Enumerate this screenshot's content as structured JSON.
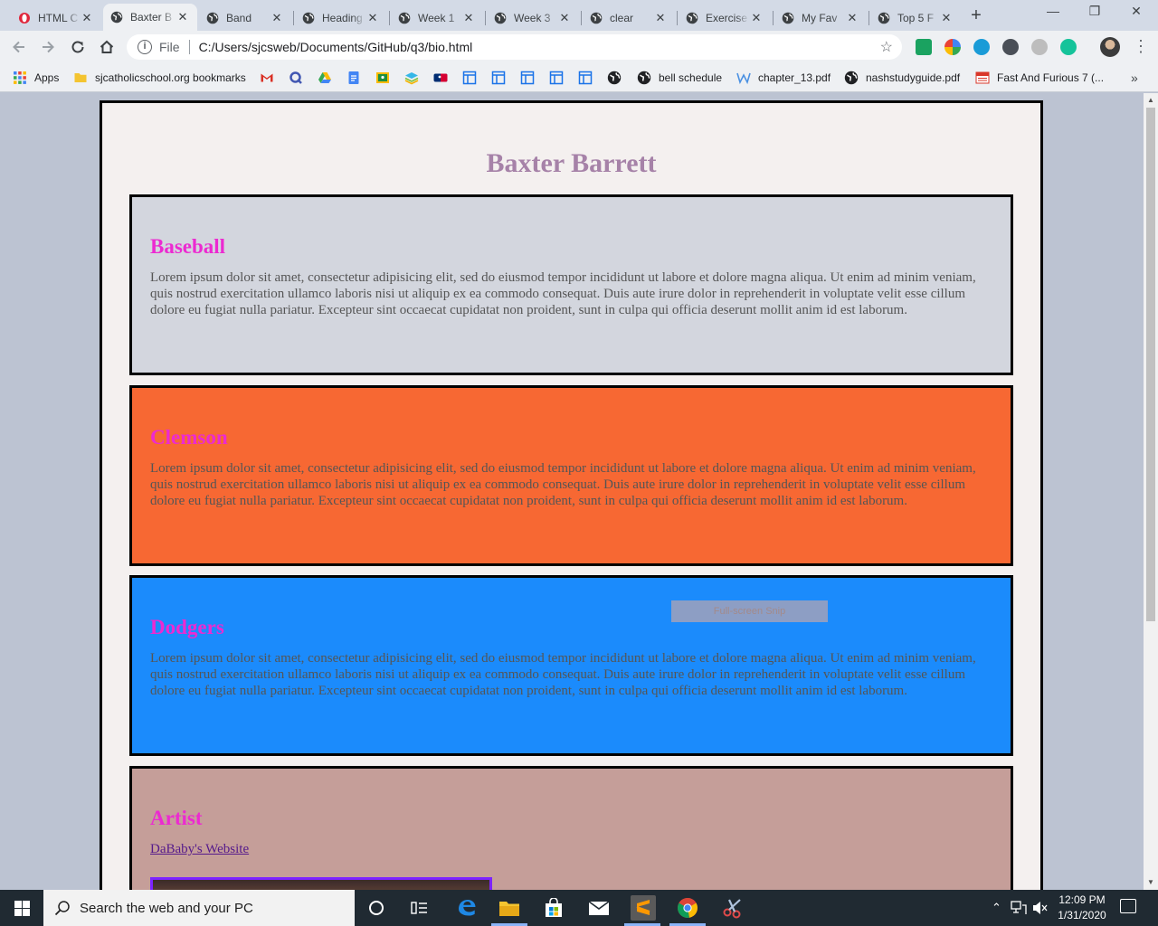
{
  "browser": {
    "tabs": [
      {
        "label": "HTML C",
        "icon": "opera-icon"
      },
      {
        "label": "Baxter B",
        "icon": "globe-icon",
        "active": true
      },
      {
        "label": "Band",
        "icon": "globe-icon"
      },
      {
        "label": "Heading",
        "icon": "globe-icon"
      },
      {
        "label": "Week 1",
        "icon": "globe-icon"
      },
      {
        "label": "Week 3",
        "icon": "globe-icon"
      },
      {
        "label": "clear",
        "icon": "globe-icon"
      },
      {
        "label": "Exercise",
        "icon": "globe-icon"
      },
      {
        "label": "My Fav",
        "icon": "globe-icon"
      },
      {
        "label": "Top 5 F",
        "icon": "globe-icon"
      }
    ],
    "address": {
      "scheme_label": "File",
      "url": "C:/Users/sjcsweb/Documents/GitHub/q3/bio.html"
    },
    "bookmarks": [
      {
        "label": "Apps",
        "icon": "apps-grid-icon"
      },
      {
        "label": "sjcatholicschool.org bookmarks",
        "icon": "folder-icon"
      },
      {
        "label": "",
        "icon": "gmail-icon"
      },
      {
        "label": "",
        "icon": "quizlet-icon"
      },
      {
        "label": "",
        "icon": "google-drive-icon"
      },
      {
        "label": "",
        "icon": "google-docs-icon"
      },
      {
        "label": "",
        "icon": "google-classroom-icon"
      },
      {
        "label": "",
        "icon": "layers-icon"
      },
      {
        "label": "",
        "icon": "mlb-icon"
      },
      {
        "label": "",
        "icon": "page-layout-icon"
      },
      {
        "label": "",
        "icon": "page-layout-icon"
      },
      {
        "label": "",
        "icon": "page-layout-icon"
      },
      {
        "label": "",
        "icon": "page-layout-icon"
      },
      {
        "label": "",
        "icon": "page-layout-icon"
      },
      {
        "label": "",
        "icon": "globe-icon"
      },
      {
        "label": "bell schedule",
        "icon": "globe-icon"
      },
      {
        "label": "chapter_13.pdf",
        "icon": "word-w-icon"
      },
      {
        "label": "nashstudyguide.pdf",
        "icon": "globe-icon"
      },
      {
        "label": "Fast And Furious 7 (...",
        "icon": "calendar-icon"
      }
    ]
  },
  "page": {
    "title": "Baxter Barrett",
    "sections": [
      {
        "heading": "Baseball",
        "body": "Lorem ipsum dolor sit amet, consectetur adipisicing elit, sed do eiusmod tempor incididunt ut labore et dolore magna aliqua. Ut enim ad minim veniam, quis nostrud exercitation ullamco laboris nisi ut aliquip ex ea commodo consequat. Duis aute irure dolor in reprehenderit in voluptate velit esse cillum dolore eu fugiat nulla pariatur. Excepteur sint occaecat cupidatat non proident, sunt in culpa qui officia deserunt mollit anim id est laborum.",
        "background": "#d3d6de"
      },
      {
        "heading": "Clemson",
        "body": "Lorem ipsum dolor sit amet, consectetur adipisicing elit, sed do eiusmod tempor incididunt ut labore et dolore magna aliqua. Ut enim ad minim veniam, quis nostrud exercitation ullamco laboris nisi ut aliquip ex ea commodo consequat. Duis aute irure dolor in reprehenderit in voluptate velit esse cillum dolore eu fugiat nulla pariatur. Excepteur sint occaecat cupidatat non proident, sunt in culpa qui officia deserunt mollit anim id est laborum.",
        "background": "#f76833"
      },
      {
        "heading": "Dodgers",
        "body": "Lorem ipsum dolor sit amet, consectetur adipisicing elit, sed do eiusmod tempor incididunt ut labore et dolore magna aliqua. Ut enim ad minim veniam, quis nostrud exercitation ullamco laboris nisi ut aliquip ex ea commodo consequat. Duis aute irure dolor in reprehenderit in voluptate velit esse cillum dolore eu fugiat nulla pariatur. Excepteur sint occaecat cupidatat non proident, sunt in culpa qui officia deserunt mollit anim id est laborum.",
        "background": "#1b8bfc"
      },
      {
        "heading": "Artist",
        "link": "DaBaby's Website",
        "background": "#c59e99"
      }
    ],
    "snip_tooltip": "Full-screen Snip"
  },
  "taskbar": {
    "search_placeholder": "Search the web and your PC",
    "time": "12:09 PM",
    "date": "1/31/2020"
  },
  "colors": {
    "heading_pink": "#ec2ad1",
    "title_purple": "#a682a8",
    "page_bg": "#f4f0ef"
  }
}
